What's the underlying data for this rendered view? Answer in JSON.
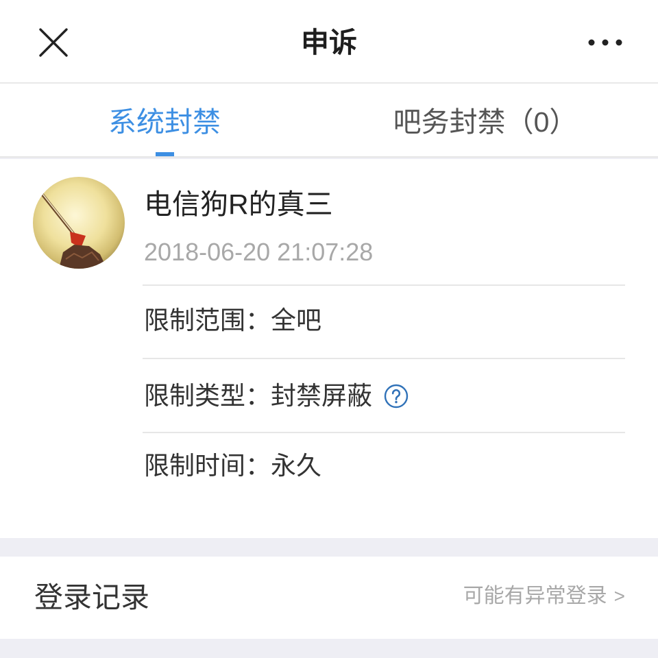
{
  "header": {
    "title": "申诉",
    "close_icon": "close-icon",
    "more_icon": "more-icon"
  },
  "tabs": [
    {
      "label": "系统封禁",
      "active": true
    },
    {
      "label": "吧务封禁（0）",
      "active": false
    }
  ],
  "ban_record": {
    "user_name": "电信狗R的真三",
    "time": "2018-06-20 21:07:28",
    "details": [
      {
        "label": "限制范围：",
        "value": "全吧"
      },
      {
        "label": "限制类型：",
        "value": "封禁屏蔽",
        "icon": "help-icon"
      },
      {
        "label": "限制时间：",
        "value": "永久"
      }
    ]
  },
  "login_record": {
    "title": "登录记录",
    "hint": "可能有异常登录",
    "chevron": ">"
  },
  "colors": {
    "accent": "#3d8fe3",
    "help_icon": "#2f71b8",
    "text_primary": "#222222",
    "text_secondary": "#a8a8a8",
    "divider": "#e6e6e6",
    "background": "#eeeef4"
  }
}
